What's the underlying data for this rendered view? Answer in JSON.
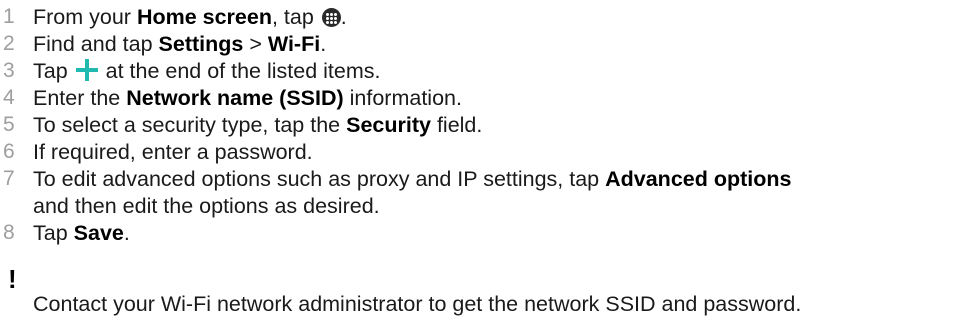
{
  "steps": [
    {
      "num": "1",
      "pre": "From your ",
      "bold1": "Home screen",
      "post": ", tap ",
      "icon": "apps-grid-icon",
      "end": "."
    },
    {
      "num": "2",
      "pre": "Find and tap ",
      "bold1": "Settings",
      "mid": " > ",
      "bold2": "Wi-Fi",
      "end": "."
    },
    {
      "num": "3",
      "pre": "Tap ",
      "icon": "plus-icon",
      "post": " at the end of the listed items."
    },
    {
      "num": "4",
      "pre": "Enter the ",
      "bold1": "Network name (SSID)",
      "post": " information."
    },
    {
      "num": "5",
      "pre": "To select a security type, tap the ",
      "bold1": "Security",
      "post": " field."
    },
    {
      "num": "6",
      "text": "If required, enter a password."
    },
    {
      "num": "7",
      "pre": "To edit advanced options such as proxy and IP settings, tap ",
      "bold1": "Advanced options",
      "cont": "and then edit the options as desired."
    },
    {
      "num": "8",
      "pre": "Tap ",
      "bold1": "Save",
      "end": "."
    }
  ],
  "note": {
    "icon": "!",
    "icon_name": "exclamation-icon",
    "text": "Contact your Wi-Fi network administrator to get the network SSID and password."
  },
  "colors": {
    "step_number": "#9e9e9e",
    "plus_icon": "#1fb9b0",
    "text": "#1a1a1a"
  }
}
